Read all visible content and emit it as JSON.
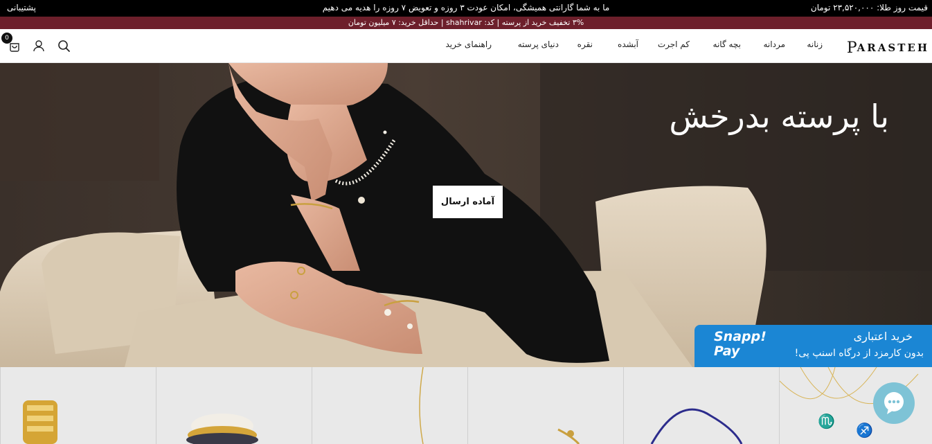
{
  "topbar": {
    "support": "پشتیبانی",
    "announcement": "ما به شما گارانتی همیشگی، امکان عودت ۳ روزه و تعویض ۷ روزه را هدیه می دهیم",
    "gold_price": "قیمت روز طلا: ۲۳,۵۲۰,۰۰۰ تومان"
  },
  "promo": {
    "text": "۳% تخفیف خرید از پرسته | کد: shahrivar | حداقل خرید: ۷ میلیون تومان"
  },
  "header": {
    "logo_big": "P",
    "logo_rest": "ARASTEH",
    "nav": [
      "زنانه",
      "مردانه",
      "بچه گانه",
      "کم اجرت",
      "آبشده",
      "نقره",
      "دنیای پرسته",
      "راهنمای خرید"
    ],
    "cart_count": "0"
  },
  "icons": {
    "cart": "cart-icon",
    "account": "user-icon",
    "search": "search-icon",
    "chat": "chat-icon"
  },
  "hero": {
    "title": "با پرسته بدرخش",
    "button": "آماده ارسال"
  },
  "snapp": {
    "logo_line1": "Snapp!",
    "logo_line2": "Pay",
    "line1": "خرید اعتباری",
    "line2": "بدون کارمزد از درگاه اسنپ پی!"
  },
  "colors": {
    "topbar": "#000000",
    "promo": "#6d1f2b",
    "snapp": "#1b86d4",
    "chat": "#7ec3d6"
  }
}
